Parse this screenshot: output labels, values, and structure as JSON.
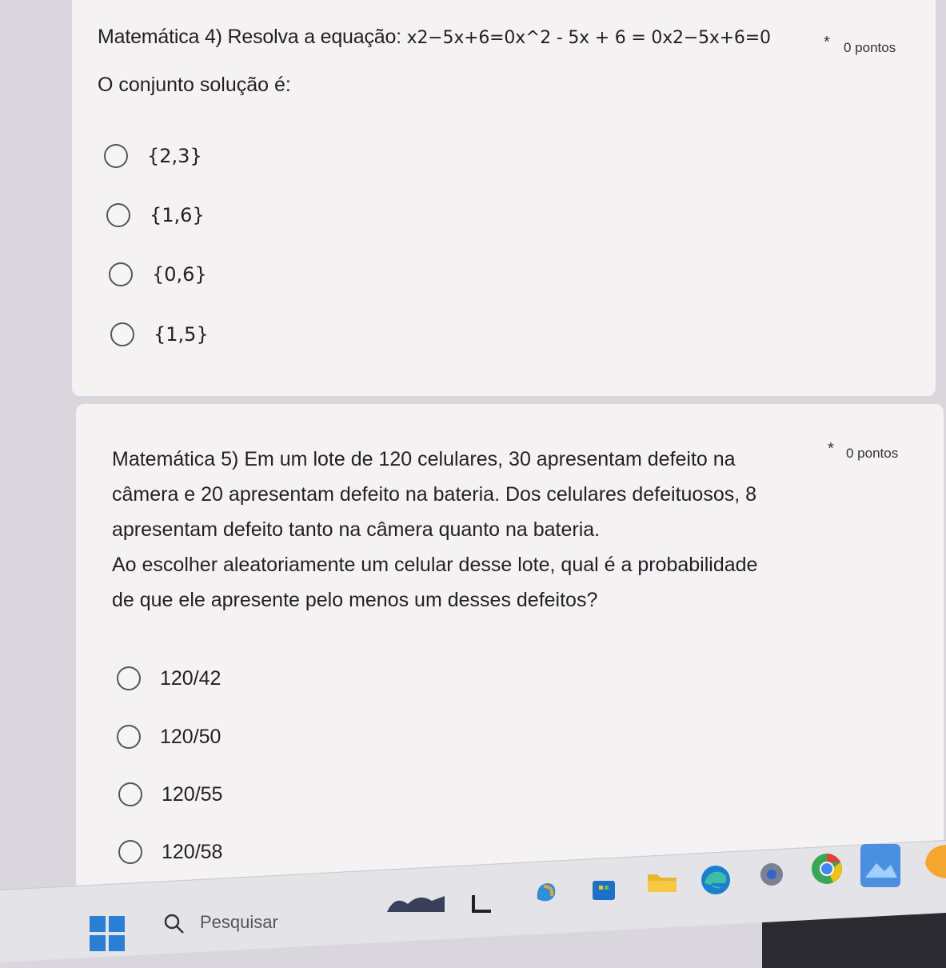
{
  "question4": {
    "title": "Matemática 4) Resolva a equação: ",
    "equation": "x2−5x+6=0x^2 - 5x + 6 = 0x2−5x+6=0",
    "required": "*",
    "points": "0 pontos",
    "subtitle": "O conjunto solução é:",
    "options": [
      "{2,3}",
      "{1,6}",
      "{0,6}",
      "{1,5}"
    ]
  },
  "question5": {
    "lines": [
      "Matemática 5)  Em um lote de 120 celulares, 30 apresentam defeito na",
      "câmera e 20 apresentam defeito na bateria. Dos celulares defeituosos, 8",
      "apresentam defeito tanto na câmera quanto na bateria.",
      "Ao escolher aleatoriamente um celular desse lote, qual é a probabilidade",
      "de que ele apresente pelo menos um desses defeitos?"
    ],
    "required": "*",
    "points": "0 pontos",
    "options": [
      "120/42",
      "120/50",
      "120/55",
      "120/58"
    ]
  },
  "taskbar": {
    "search_placeholder": "Pesquisar",
    "icons": [
      "windows-start-icon",
      "search-icon",
      "widgets-icon",
      "task-view-icon",
      "copilot-icon",
      "store-icon",
      "file-explorer-icon",
      "edge-icon",
      "settings-icon",
      "chrome-icon",
      "photos-icon",
      "app-icon"
    ]
  },
  "colors": {
    "card": "#f4f2f3",
    "background": "#d9d6dd",
    "radio_border": "#55555c",
    "taskbar": "#e4e3e7"
  }
}
